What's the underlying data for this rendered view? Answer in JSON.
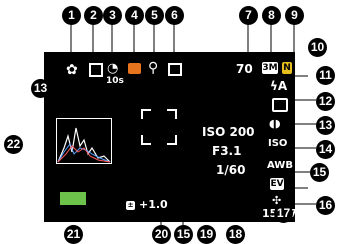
{
  "callouts": {
    "c1": "1",
    "c2": "2",
    "c3": "3",
    "c4": "4",
    "c5": "5",
    "c6": "6",
    "c7": "7",
    "c8": "8",
    "c9": "9",
    "c10": "10",
    "c11": "11",
    "c12": "12",
    "c13a": "13",
    "c13b": "13",
    "c14": "14",
    "c15a": "15",
    "c15b": "15",
    "c16": "16",
    "c17": "17",
    "c18": "18",
    "c19": "19",
    "c20": "20",
    "c21": "21",
    "c22": "22"
  },
  "screen": {
    "self_timer_sub": "10s",
    "shots_remaining": "70",
    "image_size_badge": "3M",
    "quality_badge": "N",
    "iso_text": "ISO 200",
    "aperture_text": "F3.1",
    "shutter_text": "1/60",
    "ev_shift_text": "+1.0",
    "time_text": "15:37",
    "iso_badge": "ISO",
    "wb_badge": "AWB",
    "ev_badge": "EV"
  },
  "icons": {
    "macro": "flower-icon",
    "continuous": "continuous-shot-icon",
    "self_timer": "self-timer-icon",
    "record_mode": "camera-icon",
    "zoom": "magnifier-icon",
    "metering": "metering-icon",
    "flash": "flash-auto-icon",
    "face": "face-detection-icon",
    "anti_shake": "anti-shake-icon",
    "filter": "color-filter-icon",
    "battery": "battery-icon",
    "histogram": "histogram-icon",
    "focus_frame": "focus-frame-icon"
  },
  "colors": {
    "screen": "#000000",
    "record_mode": "#e8741e",
    "battery": "#6cc24a",
    "callout": "#000000"
  }
}
